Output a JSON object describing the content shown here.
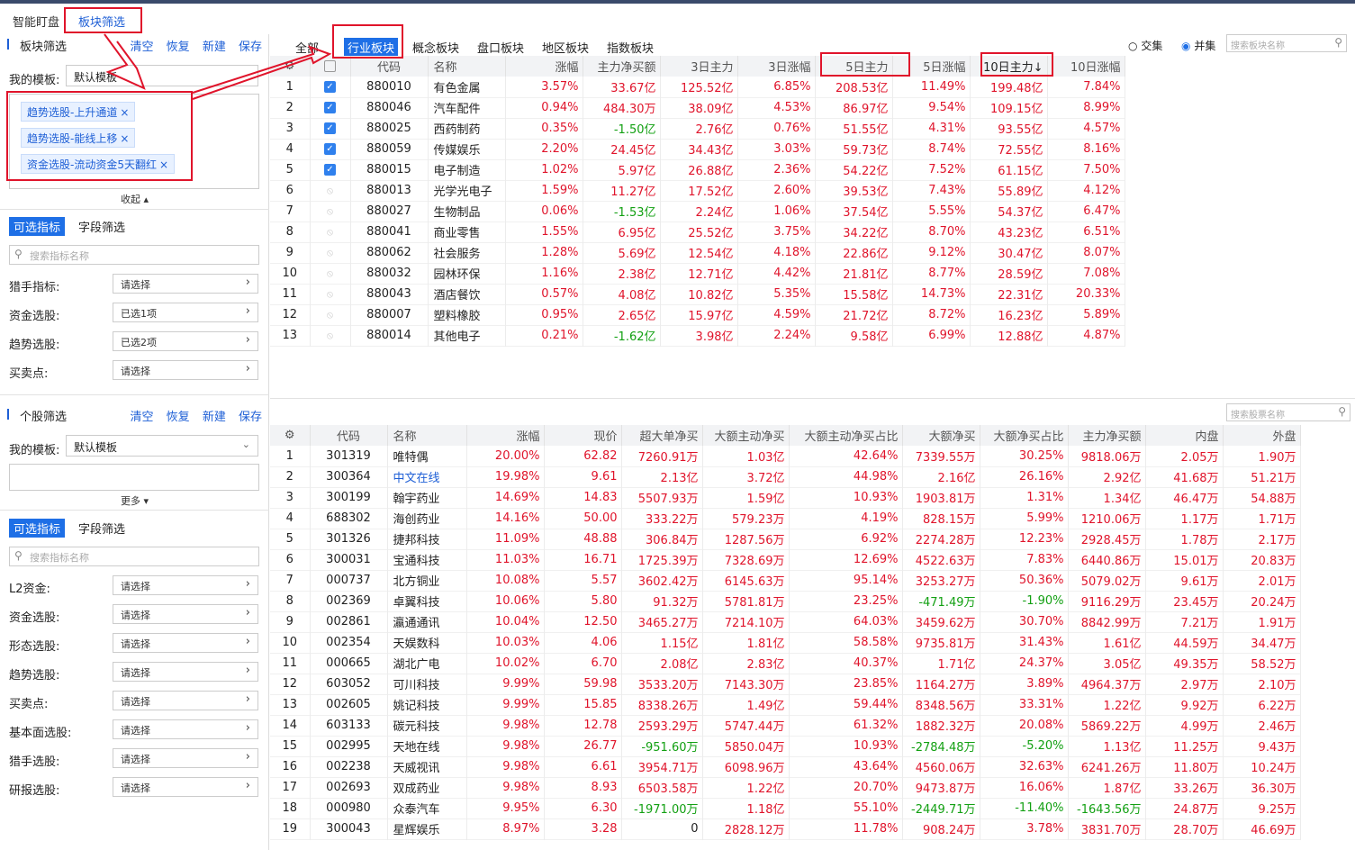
{
  "top_tabs": [
    "智能盯盘",
    "板块筛选"
  ],
  "sector_filter": {
    "title": "板块筛选",
    "actions": [
      "清空",
      "恢复",
      "新建",
      "保存"
    ],
    "template_label": "我的模板:",
    "template_value": "默认模板",
    "tags": [
      "趋势选股-上升通道",
      "趋势选股-能线上移",
      "资金选股-流动资金5天翻红"
    ],
    "collapse_label": "收起 ▴",
    "subtabs": [
      "可选指标",
      "字段筛选"
    ],
    "search_placeholder": "搜索指标名称",
    "filters": [
      {
        "label": "猎手指标:",
        "value": "请选择"
      },
      {
        "label": "资金选股:",
        "value": "已选1项"
      },
      {
        "label": "趋势选股:",
        "value": "已选2项"
      },
      {
        "label": "买卖点:",
        "value": "请选择"
      }
    ]
  },
  "stock_filter": {
    "title": "个股筛选",
    "actions": [
      "清空",
      "恢复",
      "新建",
      "保存"
    ],
    "template_label": "我的模板:",
    "template_value": "默认模板",
    "more_label": "更多 ▾",
    "subtabs": [
      "可选指标",
      "字段筛选"
    ],
    "search_placeholder": "搜索指标名称",
    "filters": [
      {
        "label": "L2资金:",
        "value": "请选择"
      },
      {
        "label": "资金选股:",
        "value": "请选择"
      },
      {
        "label": "形态选股:",
        "value": "请选择"
      },
      {
        "label": "趋势选股:",
        "value": "请选择"
      },
      {
        "label": "买卖点:",
        "value": "请选择"
      },
      {
        "label": "基本面选股:",
        "value": "请选择"
      },
      {
        "label": "猎手选股:",
        "value": "请选择"
      },
      {
        "label": "研报选股:",
        "value": "请选择"
      }
    ]
  },
  "board_tabs": [
    "全部",
    "行业板块",
    "概念板块",
    "盘口板块",
    "地区板块",
    "指数板块"
  ],
  "merge_options": {
    "intersection": "交集",
    "union": "并集"
  },
  "board_search_placeholder": "搜索板块名称",
  "stock_search_placeholder": "搜索股票名称",
  "board_table": {
    "headers": [
      "代码",
      "名称",
      "涨幅",
      "主力净买额",
      "3日主力",
      "3日涨幅",
      "5日主力",
      "5日涨幅",
      "10日主力↓",
      "10日涨幅"
    ],
    "rows": [
      {
        "idx": "1",
        "check": "on",
        "code": "880010",
        "name": "有色金属",
        "chg": "3.57%",
        "net": "33.67亿",
        "m3": "125.52亿",
        "c3": "6.85%",
        "m5": "208.53亿",
        "c5": "11.49%",
        "m10": "199.48亿",
        "c10": "7.84%"
      },
      {
        "idx": "2",
        "check": "on",
        "code": "880046",
        "name": "汽车配件",
        "chg": "0.94%",
        "net": "484.30万",
        "m3": "38.09亿",
        "c3": "4.53%",
        "m5": "86.97亿",
        "c5": "9.54%",
        "m10": "109.15亿",
        "c10": "8.99%"
      },
      {
        "idx": "3",
        "check": "on",
        "code": "880025",
        "name": "西药制药",
        "chg": "0.35%",
        "net": "-1.50亿",
        "m3": "2.76亿",
        "c3": "0.76%",
        "m5": "51.55亿",
        "c5": "4.31%",
        "m10": "93.55亿",
        "c10": "4.57%"
      },
      {
        "idx": "4",
        "check": "on",
        "code": "880059",
        "name": "传媒娱乐",
        "chg": "2.20%",
        "net": "24.45亿",
        "m3": "34.43亿",
        "c3": "3.03%",
        "m5": "59.73亿",
        "c5": "8.74%",
        "m10": "72.55亿",
        "c10": "8.16%"
      },
      {
        "idx": "5",
        "check": "on",
        "code": "880015",
        "name": "电子制造",
        "chg": "1.02%",
        "net": "5.97亿",
        "m3": "26.88亿",
        "c3": "2.36%",
        "m5": "54.22亿",
        "c5": "7.52%",
        "m10": "61.15亿",
        "c10": "7.50%"
      },
      {
        "idx": "6",
        "check": "dis",
        "code": "880013",
        "name": "光学光电子",
        "chg": "1.59%",
        "net": "11.27亿",
        "m3": "17.52亿",
        "c3": "2.60%",
        "m5": "39.53亿",
        "c5": "7.43%",
        "m10": "55.89亿",
        "c10": "4.12%"
      },
      {
        "idx": "7",
        "check": "dis",
        "code": "880027",
        "name": "生物制品",
        "chg": "0.06%",
        "net": "-1.53亿",
        "m3": "2.24亿",
        "c3": "1.06%",
        "m5": "37.54亿",
        "c5": "5.55%",
        "m10": "54.37亿",
        "c10": "6.47%"
      },
      {
        "idx": "8",
        "check": "dis",
        "code": "880041",
        "name": "商业零售",
        "chg": "1.55%",
        "net": "6.95亿",
        "m3": "25.52亿",
        "c3": "3.75%",
        "m5": "34.22亿",
        "c5": "8.70%",
        "m10": "43.23亿",
        "c10": "6.51%"
      },
      {
        "idx": "9",
        "check": "dis",
        "code": "880062",
        "name": "社会服务",
        "chg": "1.28%",
        "net": "5.69亿",
        "m3": "12.54亿",
        "c3": "4.18%",
        "m5": "22.86亿",
        "c5": "9.12%",
        "m10": "30.47亿",
        "c10": "8.07%"
      },
      {
        "idx": "10",
        "check": "dis",
        "code": "880032",
        "name": "园林环保",
        "chg": "1.16%",
        "net": "2.38亿",
        "m3": "12.71亿",
        "c3": "4.42%",
        "m5": "21.81亿",
        "c5": "8.77%",
        "m10": "28.59亿",
        "c10": "7.08%"
      },
      {
        "idx": "11",
        "check": "dis",
        "code": "880043",
        "name": "酒店餐饮",
        "chg": "0.57%",
        "net": "4.08亿",
        "m3": "10.82亿",
        "c3": "5.35%",
        "m5": "15.58亿",
        "c5": "14.73%",
        "m10": "22.31亿",
        "c10": "20.33%"
      },
      {
        "idx": "12",
        "check": "dis",
        "code": "880007",
        "name": "塑料橡胶",
        "chg": "0.95%",
        "net": "2.65亿",
        "m3": "15.97亿",
        "c3": "4.59%",
        "m5": "21.72亿",
        "c5": "8.72%",
        "m10": "16.23亿",
        "c10": "5.89%"
      },
      {
        "idx": "13",
        "check": "dis",
        "code": "880014",
        "name": "其他电子",
        "chg": "0.21%",
        "net": "-1.62亿",
        "m3": "3.98亿",
        "c3": "2.24%",
        "m5": "9.58亿",
        "c5": "6.99%",
        "m10": "12.88亿",
        "c10": "4.87%"
      }
    ]
  },
  "stock_table": {
    "headers": [
      "代码",
      "名称",
      "涨幅",
      "现价",
      "超大单净买",
      "大额主动净买",
      "大额主动净买占比",
      "大额净买",
      "大额净买占比",
      "主力净买额",
      "内盘",
      "外盘"
    ],
    "rows": [
      {
        "idx": "1",
        "code": "301319",
        "name": "唯特偶",
        "chg": "20.00%",
        "price": "62.82",
        "xl": "7260.91万",
        "act": "1.03亿",
        "actp": "42.64%",
        "big": "7339.55万",
        "bigp": "30.25%",
        "main": "9818.06万",
        "inn": "2.05万",
        "out": "1.90万"
      },
      {
        "idx": "2",
        "code": "300364",
        "name": "中文在线",
        "chg": "19.98%",
        "price": "9.61",
        "xl": "2.13亿",
        "act": "3.72亿",
        "actp": "44.98%",
        "big": "2.16亿",
        "bigp": "26.16%",
        "main": "2.92亿",
        "inn": "41.68万",
        "out": "51.21万"
      },
      {
        "idx": "3",
        "code": "300199",
        "name": "翰宇药业",
        "chg": "14.69%",
        "price": "14.83",
        "xl": "5507.93万",
        "act": "1.59亿",
        "actp": "10.93%",
        "big": "1903.81万",
        "bigp": "1.31%",
        "main": "1.34亿",
        "inn": "46.47万",
        "out": "54.88万"
      },
      {
        "idx": "4",
        "code": "688302",
        "name": "海创药业",
        "chg": "14.16%",
        "price": "50.00",
        "xl": "333.22万",
        "act": "579.23万",
        "actp": "4.19%",
        "big": "828.15万",
        "bigp": "5.99%",
        "main": "1210.06万",
        "inn": "1.17万",
        "out": "1.71万"
      },
      {
        "idx": "5",
        "code": "301326",
        "name": "捷邦科技",
        "chg": "11.09%",
        "price": "48.88",
        "xl": "306.84万",
        "act": "1287.56万",
        "actp": "6.92%",
        "big": "2274.28万",
        "bigp": "12.23%",
        "main": "2928.45万",
        "inn": "1.78万",
        "out": "2.17万"
      },
      {
        "idx": "6",
        "code": "300031",
        "name": "宝通科技",
        "chg": "11.03%",
        "price": "16.71",
        "xl": "1725.39万",
        "act": "7328.69万",
        "actp": "12.69%",
        "big": "4522.63万",
        "bigp": "7.83%",
        "main": "6440.86万",
        "inn": "15.01万",
        "out": "20.83万"
      },
      {
        "idx": "7",
        "code": "000737",
        "name": "北方铜业",
        "chg": "10.08%",
        "price": "5.57",
        "xl": "3602.42万",
        "act": "6145.63万",
        "actp": "95.14%",
        "big": "3253.27万",
        "bigp": "50.36%",
        "main": "5079.02万",
        "inn": "9.61万",
        "out": "2.01万"
      },
      {
        "idx": "8",
        "code": "002369",
        "name": "卓翼科技",
        "chg": "10.06%",
        "price": "5.80",
        "xl": "91.32万",
        "act": "5781.81万",
        "actp": "23.25%",
        "big": "-471.49万",
        "bigp": "-1.90%",
        "main": "9116.29万",
        "inn": "23.45万",
        "out": "20.24万"
      },
      {
        "idx": "9",
        "code": "002861",
        "name": "瀛通通讯",
        "chg": "10.04%",
        "price": "12.50",
        "xl": "3465.27万",
        "act": "7214.10万",
        "actp": "64.03%",
        "big": "3459.62万",
        "bigp": "30.70%",
        "main": "8842.99万",
        "inn": "7.21万",
        "out": "1.91万"
      },
      {
        "idx": "10",
        "code": "002354",
        "name": "天娱数科",
        "chg": "10.03%",
        "price": "4.06",
        "xl": "1.15亿",
        "act": "1.81亿",
        "actp": "58.58%",
        "big": "9735.81万",
        "bigp": "31.43%",
        "main": "1.61亿",
        "inn": "44.59万",
        "out": "34.47万"
      },
      {
        "idx": "11",
        "code": "000665",
        "name": "湖北广电",
        "chg": "10.02%",
        "price": "6.70",
        "xl": "2.08亿",
        "act": "2.83亿",
        "actp": "40.37%",
        "big": "1.71亿",
        "bigp": "24.37%",
        "main": "3.05亿",
        "inn": "49.35万",
        "out": "58.52万"
      },
      {
        "idx": "12",
        "code": "603052",
        "name": "可川科技",
        "chg": "9.99%",
        "price": "59.98",
        "xl": "3533.20万",
        "act": "7143.30万",
        "actp": "23.85%",
        "big": "1164.27万",
        "bigp": "3.89%",
        "main": "4964.37万",
        "inn": "2.97万",
        "out": "2.10万"
      },
      {
        "idx": "13",
        "code": "002605",
        "name": "姚记科技",
        "chg": "9.99%",
        "price": "15.85",
        "xl": "8338.26万",
        "act": "1.49亿",
        "actp": "59.44%",
        "big": "8348.56万",
        "bigp": "33.31%",
        "main": "1.22亿",
        "inn": "9.92万",
        "out": "6.22万"
      },
      {
        "idx": "14",
        "code": "603133",
        "name": "碳元科技",
        "chg": "9.98%",
        "price": "12.78",
        "xl": "2593.29万",
        "act": "5747.44万",
        "actp": "61.32%",
        "big": "1882.32万",
        "bigp": "20.08%",
        "main": "5869.22万",
        "inn": "4.99万",
        "out": "2.46万"
      },
      {
        "idx": "15",
        "code": "002995",
        "name": "天地在线",
        "chg": "9.98%",
        "price": "26.77",
        "xl": "-951.60万",
        "act": "5850.04万",
        "actp": "10.93%",
        "big": "-2784.48万",
        "bigp": "-5.20%",
        "main": "1.13亿",
        "inn": "11.25万",
        "out": "9.43万"
      },
      {
        "idx": "16",
        "code": "002238",
        "name": "天威视讯",
        "chg": "9.98%",
        "price": "6.61",
        "xl": "3954.71万",
        "act": "6098.96万",
        "actp": "43.64%",
        "big": "4560.06万",
        "bigp": "32.63%",
        "main": "6241.26万",
        "inn": "11.80万",
        "out": "10.24万"
      },
      {
        "idx": "17",
        "code": "002693",
        "name": "双成药业",
        "chg": "9.98%",
        "price": "8.93",
        "xl": "6503.58万",
        "act": "1.22亿",
        "actp": "20.70%",
        "big": "9473.87万",
        "bigp": "16.06%",
        "main": "1.87亿",
        "inn": "33.26万",
        "out": "36.30万"
      },
      {
        "idx": "18",
        "code": "000980",
        "name": "众泰汽车",
        "chg": "9.95%",
        "price": "6.30",
        "xl": "-1971.00万",
        "act": "1.18亿",
        "actp": "55.10%",
        "big": "-2449.71万",
        "bigp": "-11.40%",
        "main": "-1643.56万",
        "inn": "24.87万",
        "out": "9.25万"
      },
      {
        "idx": "19",
        "code": "300043",
        "name": "星辉娱乐",
        "chg": "8.97%",
        "price": "3.28",
        "xl": "0",
        "act": "2828.12万",
        "actp": "11.78%",
        "big": "908.24万",
        "bigp": "3.78%",
        "main": "3831.70万",
        "inn": "28.70万",
        "out": "46.69万"
      }
    ]
  },
  "colors": {
    "accent": "#1e6fe6",
    "up": "#e0142b",
    "down": "#12a012",
    "annotation": "#e0142b"
  }
}
